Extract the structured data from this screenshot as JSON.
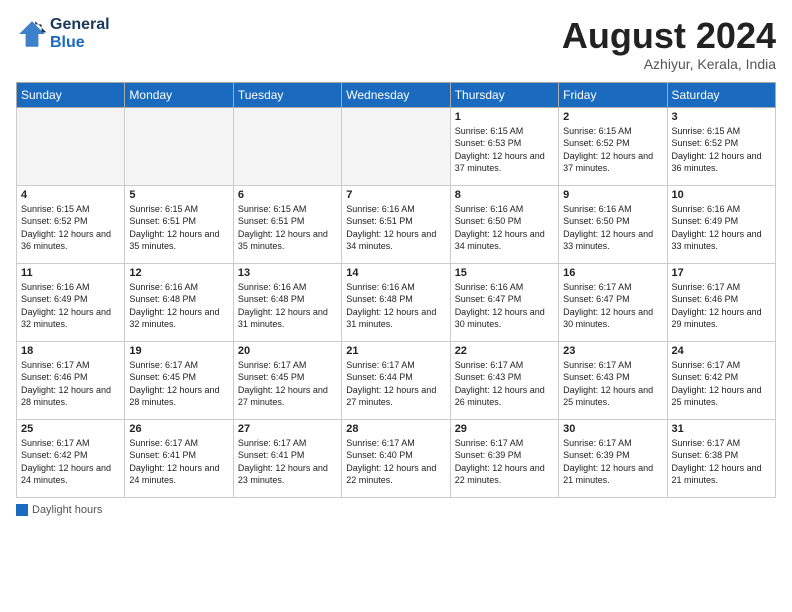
{
  "header": {
    "logo_line1": "General",
    "logo_line2": "Blue",
    "month_year": "August 2024",
    "location": "Azhiyur, Kerala, India"
  },
  "weekdays": [
    "Sunday",
    "Monday",
    "Tuesday",
    "Wednesday",
    "Thursday",
    "Friday",
    "Saturday"
  ],
  "weeks": [
    [
      {
        "day": "",
        "empty": true
      },
      {
        "day": "",
        "empty": true
      },
      {
        "day": "",
        "empty": true
      },
      {
        "day": "",
        "empty": true
      },
      {
        "day": "1",
        "sunrise": "6:15 AM",
        "sunset": "6:53 PM",
        "daylight": "12 hours and 37 minutes."
      },
      {
        "day": "2",
        "sunrise": "6:15 AM",
        "sunset": "6:52 PM",
        "daylight": "12 hours and 37 minutes."
      },
      {
        "day": "3",
        "sunrise": "6:15 AM",
        "sunset": "6:52 PM",
        "daylight": "12 hours and 36 minutes."
      }
    ],
    [
      {
        "day": "4",
        "sunrise": "6:15 AM",
        "sunset": "6:52 PM",
        "daylight": "12 hours and 36 minutes."
      },
      {
        "day": "5",
        "sunrise": "6:15 AM",
        "sunset": "6:51 PM",
        "daylight": "12 hours and 35 minutes."
      },
      {
        "day": "6",
        "sunrise": "6:15 AM",
        "sunset": "6:51 PM",
        "daylight": "12 hours and 35 minutes."
      },
      {
        "day": "7",
        "sunrise": "6:16 AM",
        "sunset": "6:51 PM",
        "daylight": "12 hours and 34 minutes."
      },
      {
        "day": "8",
        "sunrise": "6:16 AM",
        "sunset": "6:50 PM",
        "daylight": "12 hours and 34 minutes."
      },
      {
        "day": "9",
        "sunrise": "6:16 AM",
        "sunset": "6:50 PM",
        "daylight": "12 hours and 33 minutes."
      },
      {
        "day": "10",
        "sunrise": "6:16 AM",
        "sunset": "6:49 PM",
        "daylight": "12 hours and 33 minutes."
      }
    ],
    [
      {
        "day": "11",
        "sunrise": "6:16 AM",
        "sunset": "6:49 PM",
        "daylight": "12 hours and 32 minutes."
      },
      {
        "day": "12",
        "sunrise": "6:16 AM",
        "sunset": "6:48 PM",
        "daylight": "12 hours and 32 minutes."
      },
      {
        "day": "13",
        "sunrise": "6:16 AM",
        "sunset": "6:48 PM",
        "daylight": "12 hours and 31 minutes."
      },
      {
        "day": "14",
        "sunrise": "6:16 AM",
        "sunset": "6:48 PM",
        "daylight": "12 hours and 31 minutes."
      },
      {
        "day": "15",
        "sunrise": "6:16 AM",
        "sunset": "6:47 PM",
        "daylight": "12 hours and 30 minutes."
      },
      {
        "day": "16",
        "sunrise": "6:17 AM",
        "sunset": "6:47 PM",
        "daylight": "12 hours and 30 minutes."
      },
      {
        "day": "17",
        "sunrise": "6:17 AM",
        "sunset": "6:46 PM",
        "daylight": "12 hours and 29 minutes."
      }
    ],
    [
      {
        "day": "18",
        "sunrise": "6:17 AM",
        "sunset": "6:46 PM",
        "daylight": "12 hours and 28 minutes."
      },
      {
        "day": "19",
        "sunrise": "6:17 AM",
        "sunset": "6:45 PM",
        "daylight": "12 hours and 28 minutes."
      },
      {
        "day": "20",
        "sunrise": "6:17 AM",
        "sunset": "6:45 PM",
        "daylight": "12 hours and 27 minutes."
      },
      {
        "day": "21",
        "sunrise": "6:17 AM",
        "sunset": "6:44 PM",
        "daylight": "12 hours and 27 minutes."
      },
      {
        "day": "22",
        "sunrise": "6:17 AM",
        "sunset": "6:43 PM",
        "daylight": "12 hours and 26 minutes."
      },
      {
        "day": "23",
        "sunrise": "6:17 AM",
        "sunset": "6:43 PM",
        "daylight": "12 hours and 25 minutes."
      },
      {
        "day": "24",
        "sunrise": "6:17 AM",
        "sunset": "6:42 PM",
        "daylight": "12 hours and 25 minutes."
      }
    ],
    [
      {
        "day": "25",
        "sunrise": "6:17 AM",
        "sunset": "6:42 PM",
        "daylight": "12 hours and 24 minutes."
      },
      {
        "day": "26",
        "sunrise": "6:17 AM",
        "sunset": "6:41 PM",
        "daylight": "12 hours and 24 minutes."
      },
      {
        "day": "27",
        "sunrise": "6:17 AM",
        "sunset": "6:41 PM",
        "daylight": "12 hours and 23 minutes."
      },
      {
        "day": "28",
        "sunrise": "6:17 AM",
        "sunset": "6:40 PM",
        "daylight": "12 hours and 22 minutes."
      },
      {
        "day": "29",
        "sunrise": "6:17 AM",
        "sunset": "6:39 PM",
        "daylight": "12 hours and 22 minutes."
      },
      {
        "day": "30",
        "sunrise": "6:17 AM",
        "sunset": "6:39 PM",
        "daylight": "12 hours and 21 minutes."
      },
      {
        "day": "31",
        "sunrise": "6:17 AM",
        "sunset": "6:38 PM",
        "daylight": "12 hours and 21 minutes."
      }
    ]
  ],
  "legend": {
    "label": "Daylight hours"
  }
}
